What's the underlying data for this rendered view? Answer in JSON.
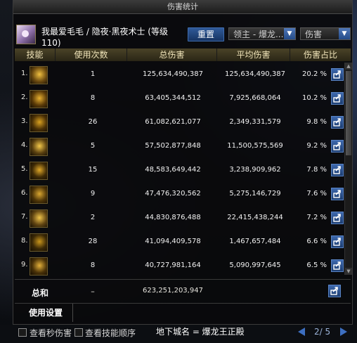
{
  "window": {
    "title": "伤害统计"
  },
  "header": {
    "player_name": "我最爱毛毛 / 隐夜·黑夜术士 (等级110)",
    "reset_label": "重置",
    "boss_select_value": "领主 - 爆龙...",
    "type_select_value": "伤害"
  },
  "columns": {
    "skill": "技能",
    "count": "使用次数",
    "total": "总伤害",
    "avg": "平均伤害",
    "share": "伤害占比"
  },
  "rows": [
    {
      "idx": "1.",
      "icon": "skill-1-icon",
      "count": "1",
      "total": "125,634,490,387",
      "avg": "125,634,490,387",
      "pct": "20.2 %"
    },
    {
      "idx": "2.",
      "icon": "skill-2-icon",
      "count": "8",
      "total": "63,405,344,512",
      "avg": "7,925,668,064",
      "pct": "10.2 %"
    },
    {
      "idx": "3.",
      "icon": "skill-3-icon",
      "count": "26",
      "total": "61,082,621,077",
      "avg": "2,349,331,579",
      "pct": "9.8 %"
    },
    {
      "idx": "4.",
      "icon": "skill-4-icon",
      "count": "5",
      "total": "57,502,877,848",
      "avg": "11,500,575,569",
      "pct": "9.2 %"
    },
    {
      "idx": "5.",
      "icon": "skill-5-icon",
      "count": "15",
      "total": "48,583,649,442",
      "avg": "3,238,909,962",
      "pct": "7.8 %"
    },
    {
      "idx": "6.",
      "icon": "skill-6-icon",
      "count": "9",
      "total": "47,476,320,562",
      "avg": "5,275,146,729",
      "pct": "7.6 %"
    },
    {
      "idx": "7.",
      "icon": "skill-7-icon",
      "count": "2",
      "total": "44,830,876,488",
      "avg": "22,415,438,244",
      "pct": "7.2 %"
    },
    {
      "idx": "8.",
      "icon": "skill-8-icon",
      "count": "28",
      "total": "41,094,409,578",
      "avg": "1,467,657,484",
      "pct": "6.6 %"
    },
    {
      "idx": "9.",
      "icon": "skill-9-icon",
      "count": "8",
      "total": "40,727,981,164",
      "avg": "5,090,997,645",
      "pct": "6.5 %"
    }
  ],
  "summary": {
    "label": "总和",
    "count": "–",
    "total": "623,251,203,947"
  },
  "settings": {
    "tab_label": "使用设置"
  },
  "footer": {
    "check_dps_label": "查看秒伤害",
    "check_order_label": "查看技能顺序",
    "dungeon_label": "地下城名 = 爆龙王正殿",
    "page_label": "2/ 5"
  },
  "colors": {
    "accent": "#2f5d9e",
    "header_gold": "#4a4328",
    "skill_gold": "#c9a227"
  }
}
